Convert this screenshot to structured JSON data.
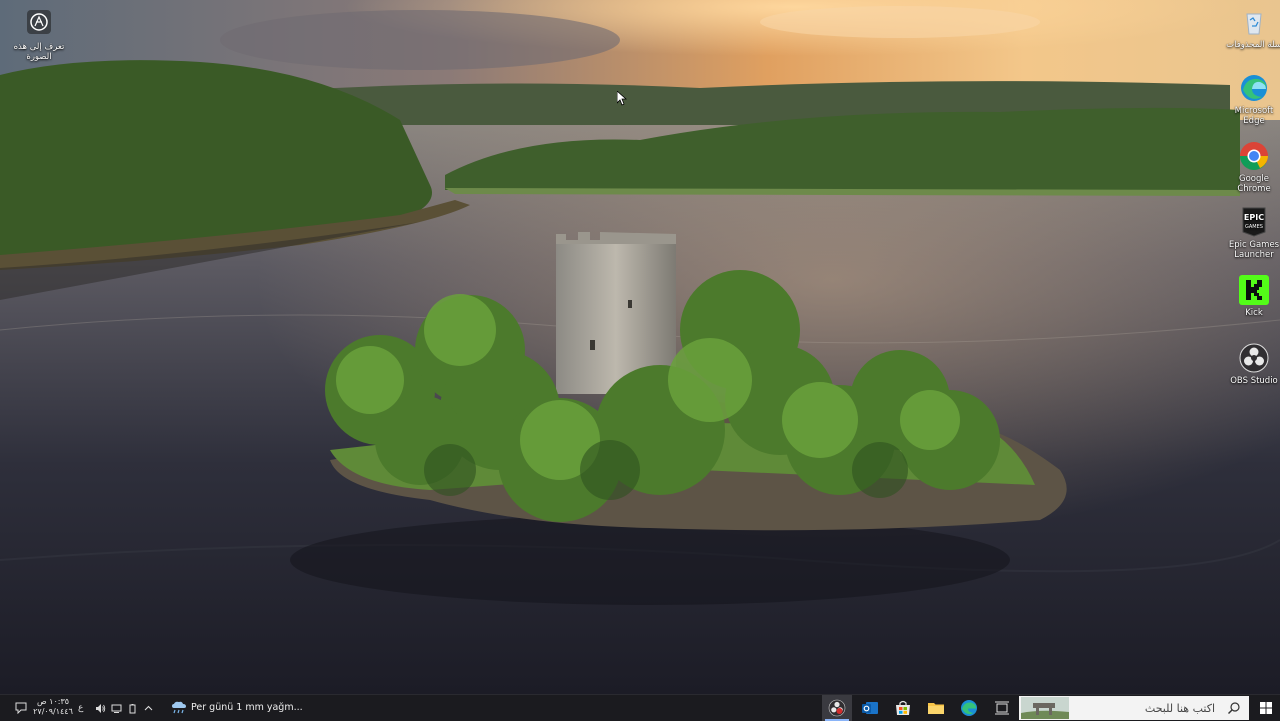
{
  "desktop": {
    "left_icons": [
      {
        "name": "learn-about-picture",
        "label": "تعرف إلى هذه الصورة",
        "icon": "camera-circle-icon"
      }
    ],
    "right_icons": [
      {
        "name": "recycle-bin",
        "label": "سلة المحذوفات",
        "icon": "recycle-bin-icon"
      },
      {
        "name": "microsoft-edge",
        "label": "Microsoft Edge",
        "icon": "edge-icon"
      },
      {
        "name": "google-chrome",
        "label": "Google Chrome",
        "icon": "chrome-icon"
      },
      {
        "name": "epic-games",
        "label": "Epic Games Launcher",
        "icon": "epic-games-icon"
      },
      {
        "name": "kick",
        "label": "Kick",
        "icon": "kick-icon"
      },
      {
        "name": "obs-studio",
        "label": "OBS Studio",
        "icon": "obs-icon"
      }
    ]
  },
  "taskbar": {
    "search_placeholder": "اكتب هنا للبحث",
    "weather_text": "Per günü 1 mm yağm...",
    "input_language": "ع",
    "clock": {
      "time": "١٠:٣٥ ص",
      "date": "٢٧/٠٩/١٤٤٦"
    },
    "apps": [
      "start-menu",
      "task-view",
      "edge",
      "file-explorer",
      "microsoft-store",
      "outlook",
      "obs-studio"
    ],
    "colors": {
      "background": "#1b1b1f",
      "search_bg": "#f3f3f3",
      "active_indicator": "#8ab4f8"
    }
  }
}
